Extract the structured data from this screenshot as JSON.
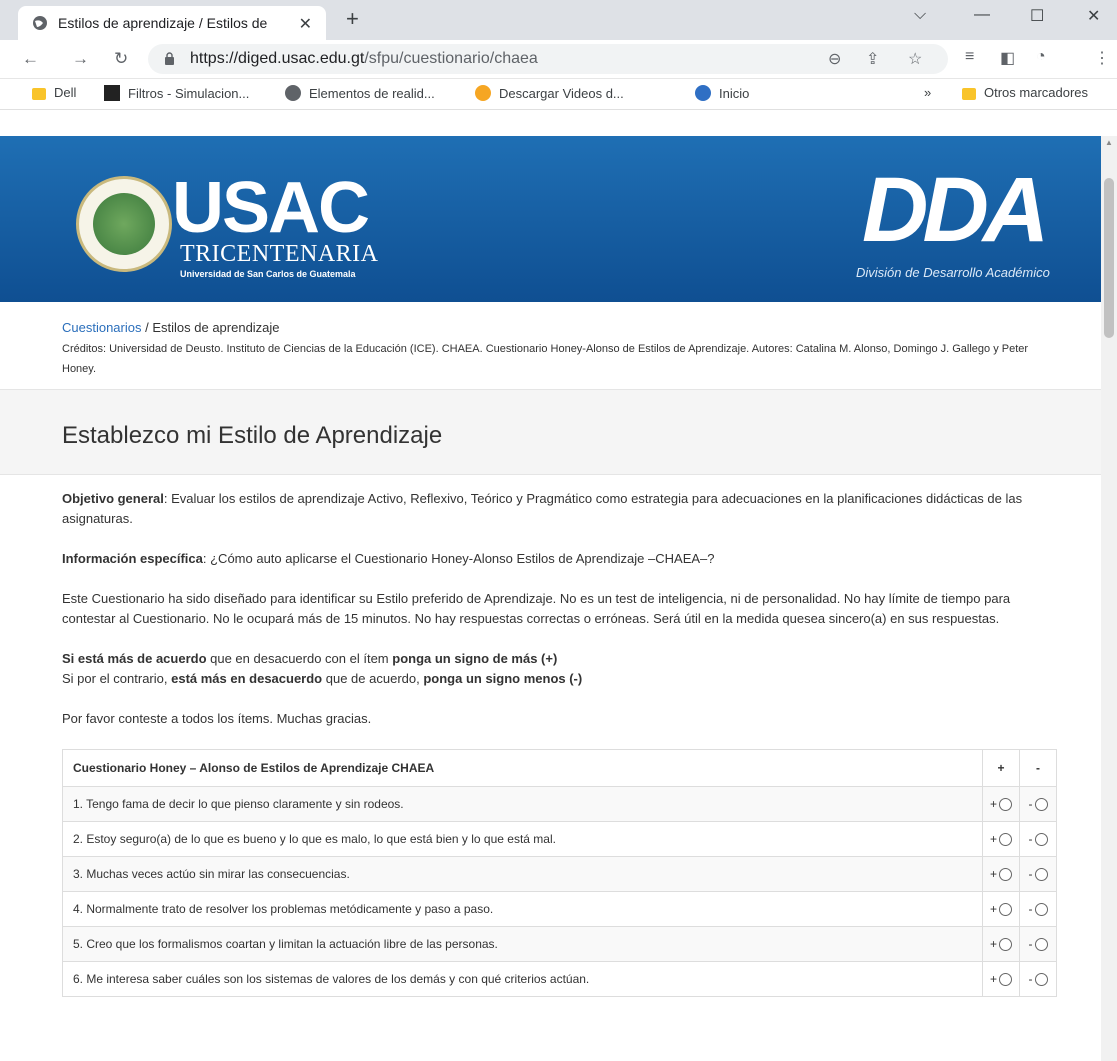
{
  "browser": {
    "tab_title": "Estilos de aprendizaje / Estilos de",
    "url_host": "https://diged.usac.edu.gt",
    "url_path": "/sfpu/cuestionario/chaea",
    "bookmarks": [
      "Dell",
      "Filtros - Simulacion...",
      "Elementos de realid...",
      "Descargar Videos d...",
      "Inicio"
    ],
    "bookmarks_more": "»",
    "other_bookmarks": "Otros marcadores"
  },
  "banner": {
    "usac": "USAC",
    "tricentenaria": "TRICENTENARIA",
    "usac_sub": "Universidad de San Carlos de Guatemala",
    "dda": "DDA",
    "dda_sub": "División de Desarrollo Académico"
  },
  "breadcrumb": {
    "link": "Cuestionarios",
    "sep": " / ",
    "current": "Estilos de aprendizaje"
  },
  "credits": "Créditos: Universidad de Deusto. Instituto de Ciencias de la Educación (ICE). CHAEA. Cuestionario Honey-Alonso de Estilos de Aprendizaje. Autores: Catalina M. Alonso, Domingo J. Gallego y Peter Honey.",
  "page_title": "Establezco mi Estilo de Aprendizaje",
  "body": {
    "objetivo_label": "Objetivo general",
    "objetivo_text": ": Evaluar los estilos de aprendizaje Activo, Reflexivo, Teórico y Pragmático como estrategia para adecuaciones en la planificaciones didácticas de las asignaturas.",
    "info_label": "Información específica",
    "info_text": ": ¿Cómo auto aplicarse el Cuestionario Honey-Alonso Estilos de Aprendizaje –CHAEA–?",
    "description": "Este Cuestionario ha sido diseñado para identificar su Estilo preferido de Aprendizaje. No es un test de inteligencia, ni de personalidad. No hay límite de tiempo para contestar al Cuestionario. No le ocupará más de 15 minutos. No hay respuestas correctas o erróneas. Será útil en la medida quesea sincero(a) en sus respuestas.",
    "rule1_a": "Si está más de acuerdo",
    "rule1_b": " que en desacuerdo con el ítem ",
    "rule1_c": "ponga un signo de más (+)",
    "rule2_a": "Si por el contrario, ",
    "rule2_b": "está más en desacuerdo",
    "rule2_c": " que de acuerdo, ",
    "rule2_d": "ponga un signo menos (-)",
    "thanks": "Por favor conteste a todos los ítems. Muchas gracias."
  },
  "table": {
    "header": "Cuestionario Honey – Alonso de Estilos de Aprendizaje CHAEA",
    "col_plus": "+",
    "col_minus": "-",
    "plus_label": "+",
    "minus_label": "-",
    "items": [
      "1. Tengo fama de decir lo que pienso claramente y sin rodeos.",
      "2. Estoy seguro(a) de lo que es bueno y lo que es malo, lo que está bien y lo que está mal.",
      "3. Muchas veces actúo sin mirar las consecuencias.",
      "4. Normalmente trato de resolver los problemas metódicamente y paso a paso.",
      "5. Creo que los formalismos coartan y limitan la actuación libre de las personas.",
      "6. Me interesa saber cuáles son los sistemas de valores de los demás y con qué criterios actúan."
    ]
  }
}
